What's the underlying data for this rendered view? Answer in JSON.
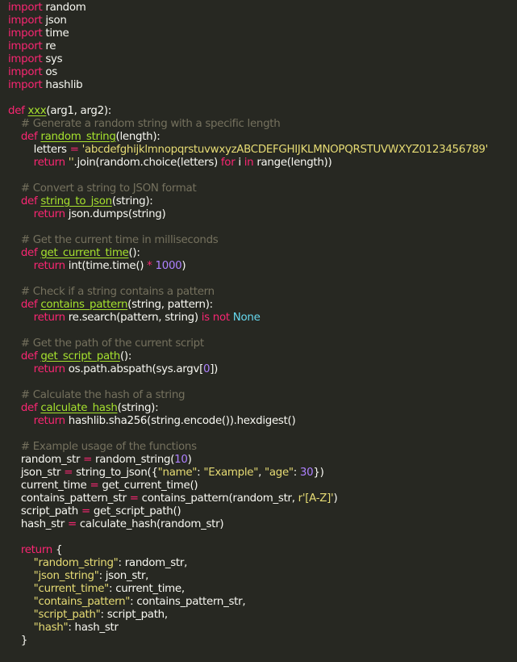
{
  "lines": [
    [
      {
        "t": "import",
        "c": "k"
      },
      {
        "t": " random",
        "c": "p"
      }
    ],
    [
      {
        "t": "import",
        "c": "k"
      },
      {
        "t": " json",
        "c": "p"
      }
    ],
    [
      {
        "t": "import",
        "c": "k"
      },
      {
        "t": " time",
        "c": "p"
      }
    ],
    [
      {
        "t": "import",
        "c": "k"
      },
      {
        "t": " re",
        "c": "p"
      }
    ],
    [
      {
        "t": "import",
        "c": "k"
      },
      {
        "t": " sys",
        "c": "p"
      }
    ],
    [
      {
        "t": "import",
        "c": "k"
      },
      {
        "t": " os",
        "c": "p"
      }
    ],
    [
      {
        "t": "import",
        "c": "k"
      },
      {
        "t": " hashlib",
        "c": "p"
      }
    ],
    [],
    [
      {
        "t": "def",
        "c": "k"
      },
      {
        "t": " ",
        "c": "p"
      },
      {
        "t": "xxx",
        "c": "fn"
      },
      {
        "t": "(arg1, arg2):",
        "c": "p"
      }
    ],
    [
      {
        "t": "    # Generate a random string with a specific length",
        "c": "c"
      }
    ],
    [
      {
        "t": "    ",
        "c": "p"
      },
      {
        "t": "def",
        "c": "k"
      },
      {
        "t": " ",
        "c": "p"
      },
      {
        "t": "random_string",
        "c": "fn"
      },
      {
        "t": "(length):",
        "c": "p"
      }
    ],
    [
      {
        "t": "        letters ",
        "c": "p"
      },
      {
        "t": "=",
        "c": "k"
      },
      {
        "t": " ",
        "c": "p"
      },
      {
        "t": "'abcdefghijklmnopqrstuvwxyzABCDEFGHIJKLMNOPQRSTUVWXYZ0123456789'",
        "c": "s"
      }
    ],
    [
      {
        "t": "        ",
        "c": "p"
      },
      {
        "t": "return",
        "c": "k"
      },
      {
        "t": " ",
        "c": "p"
      },
      {
        "t": "''",
        "c": "s"
      },
      {
        "t": ".join(random.choice(letters) ",
        "c": "p"
      },
      {
        "t": "for",
        "c": "k"
      },
      {
        "t": " i ",
        "c": "p"
      },
      {
        "t": "in",
        "c": "k"
      },
      {
        "t": " range(length))",
        "c": "p"
      }
    ],
    [],
    [
      {
        "t": "    # Convert a string to JSON format",
        "c": "c"
      }
    ],
    [
      {
        "t": "    ",
        "c": "p"
      },
      {
        "t": "def",
        "c": "k"
      },
      {
        "t": " ",
        "c": "p"
      },
      {
        "t": "string_to_json",
        "c": "fn"
      },
      {
        "t": "(string):",
        "c": "p"
      }
    ],
    [
      {
        "t": "        ",
        "c": "p"
      },
      {
        "t": "return",
        "c": "k"
      },
      {
        "t": " json.dumps(string)",
        "c": "p"
      }
    ],
    [],
    [
      {
        "t": "    # Get the current time in milliseconds",
        "c": "c"
      }
    ],
    [
      {
        "t": "    ",
        "c": "p"
      },
      {
        "t": "def",
        "c": "k"
      },
      {
        "t": " ",
        "c": "p"
      },
      {
        "t": "get_current_time",
        "c": "fn"
      },
      {
        "t": "():",
        "c": "p"
      }
    ],
    [
      {
        "t": "        ",
        "c": "p"
      },
      {
        "t": "return",
        "c": "k"
      },
      {
        "t": " int(time.time() ",
        "c": "p"
      },
      {
        "t": "*",
        "c": "k"
      },
      {
        "t": " ",
        "c": "p"
      },
      {
        "t": "1000",
        "c": "n"
      },
      {
        "t": ")",
        "c": "p"
      }
    ],
    [],
    [
      {
        "t": "    # Check if a string contains a pattern",
        "c": "c"
      }
    ],
    [
      {
        "t": "    ",
        "c": "p"
      },
      {
        "t": "def",
        "c": "k"
      },
      {
        "t": " ",
        "c": "p"
      },
      {
        "t": "contains_pattern",
        "c": "fn"
      },
      {
        "t": "(string, pattern):",
        "c": "p"
      }
    ],
    [
      {
        "t": "        ",
        "c": "p"
      },
      {
        "t": "return",
        "c": "k"
      },
      {
        "t": " re.search(pattern, string) ",
        "c": "p"
      },
      {
        "t": "is not",
        "c": "k"
      },
      {
        "t": " ",
        "c": "p"
      },
      {
        "t": "None",
        "c": "b"
      }
    ],
    [],
    [
      {
        "t": "    # Get the path of the current script",
        "c": "c"
      }
    ],
    [
      {
        "t": "    ",
        "c": "p"
      },
      {
        "t": "def",
        "c": "k"
      },
      {
        "t": " ",
        "c": "p"
      },
      {
        "t": "get_script_path",
        "c": "fn"
      },
      {
        "t": "():",
        "c": "p"
      }
    ],
    [
      {
        "t": "        ",
        "c": "p"
      },
      {
        "t": "return",
        "c": "k"
      },
      {
        "t": " os.path.abspath(sys.argv[",
        "c": "p"
      },
      {
        "t": "0",
        "c": "n"
      },
      {
        "t": "])",
        "c": "p"
      }
    ],
    [],
    [
      {
        "t": "    # Calculate the hash of a string",
        "c": "c"
      }
    ],
    [
      {
        "t": "    ",
        "c": "p"
      },
      {
        "t": "def",
        "c": "k"
      },
      {
        "t": " ",
        "c": "p"
      },
      {
        "t": "calculate_hash",
        "c": "fn"
      },
      {
        "t": "(string):",
        "c": "p"
      }
    ],
    [
      {
        "t": "        ",
        "c": "p"
      },
      {
        "t": "return",
        "c": "k"
      },
      {
        "t": " hashlib.sha256(string.encode()).hexdigest()",
        "c": "p"
      }
    ],
    [],
    [
      {
        "t": "    # Example usage of the functions",
        "c": "c"
      }
    ],
    [
      {
        "t": "    random_str ",
        "c": "p"
      },
      {
        "t": "=",
        "c": "k"
      },
      {
        "t": " random_string(",
        "c": "p"
      },
      {
        "t": "10",
        "c": "n"
      },
      {
        "t": ")",
        "c": "p"
      }
    ],
    [
      {
        "t": "    json_str ",
        "c": "p"
      },
      {
        "t": "=",
        "c": "k"
      },
      {
        "t": " string_to_json({",
        "c": "p"
      },
      {
        "t": "\"name\"",
        "c": "s"
      },
      {
        "t": ": ",
        "c": "p"
      },
      {
        "t": "\"Example\"",
        "c": "s"
      },
      {
        "t": ", ",
        "c": "p"
      },
      {
        "t": "\"age\"",
        "c": "s"
      },
      {
        "t": ": ",
        "c": "p"
      },
      {
        "t": "30",
        "c": "n"
      },
      {
        "t": "})",
        "c": "p"
      }
    ],
    [
      {
        "t": "    current_time ",
        "c": "p"
      },
      {
        "t": "=",
        "c": "k"
      },
      {
        "t": " get_current_time()",
        "c": "p"
      }
    ],
    [
      {
        "t": "    contains_pattern_str ",
        "c": "p"
      },
      {
        "t": "=",
        "c": "k"
      },
      {
        "t": " contains_pattern(random_str, ",
        "c": "p"
      },
      {
        "t": "r'[A-Z]'",
        "c": "s"
      },
      {
        "t": ")",
        "c": "p"
      }
    ],
    [
      {
        "t": "    script_path ",
        "c": "p"
      },
      {
        "t": "=",
        "c": "k"
      },
      {
        "t": " get_script_path()",
        "c": "p"
      }
    ],
    [
      {
        "t": "    hash_str ",
        "c": "p"
      },
      {
        "t": "=",
        "c": "k"
      },
      {
        "t": " calculate_hash(random_str)",
        "c": "p"
      }
    ],
    [],
    [
      {
        "t": "    ",
        "c": "p"
      },
      {
        "t": "return",
        "c": "k"
      },
      {
        "t": " {",
        "c": "p"
      }
    ],
    [
      {
        "t": "        ",
        "c": "p"
      },
      {
        "t": "\"random_string\"",
        "c": "s"
      },
      {
        "t": ": random_str,",
        "c": "p"
      }
    ],
    [
      {
        "t": "        ",
        "c": "p"
      },
      {
        "t": "\"json_string\"",
        "c": "s"
      },
      {
        "t": ": json_str,",
        "c": "p"
      }
    ],
    [
      {
        "t": "        ",
        "c": "p"
      },
      {
        "t": "\"current_time\"",
        "c": "s"
      },
      {
        "t": ": current_time,",
        "c": "p"
      }
    ],
    [
      {
        "t": "        ",
        "c": "p"
      },
      {
        "t": "\"contains_pattern\"",
        "c": "s"
      },
      {
        "t": ": contains_pattern_str,",
        "c": "p"
      }
    ],
    [
      {
        "t": "        ",
        "c": "p"
      },
      {
        "t": "\"script_path\"",
        "c": "s"
      },
      {
        "t": ": script_path,",
        "c": "p"
      }
    ],
    [
      {
        "t": "        ",
        "c": "p"
      },
      {
        "t": "\"hash\"",
        "c": "s"
      },
      {
        "t": ": hash_str",
        "c": "p"
      }
    ],
    [
      {
        "t": "    }",
        "c": "p"
      }
    ]
  ]
}
